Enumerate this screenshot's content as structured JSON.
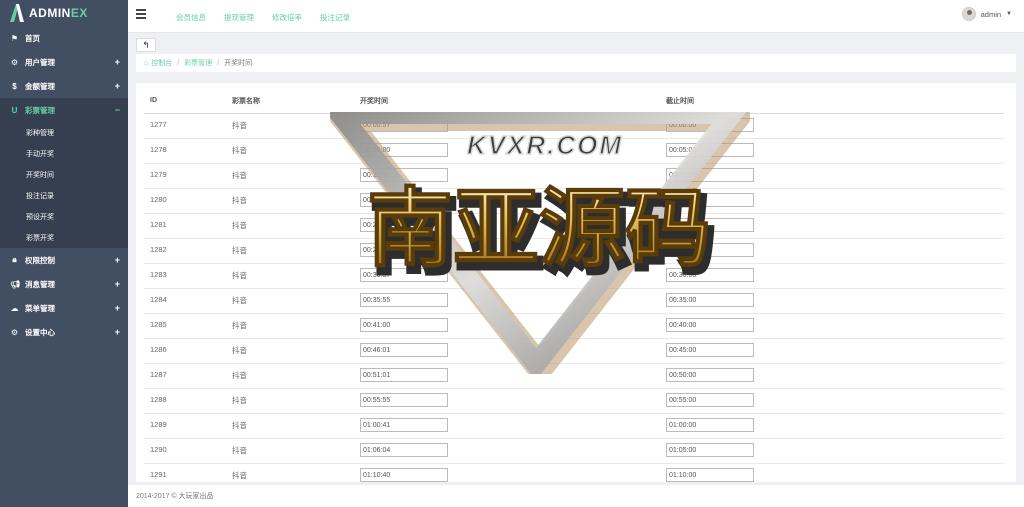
{
  "brand": {
    "prefix": "ADMIN",
    "suffix": "EX"
  },
  "sidebar": {
    "items": [
      {
        "label": "首页",
        "icon": "flag-icon",
        "glyph": "⚑",
        "toggle": ""
      },
      {
        "label": "用户管理",
        "icon": "gear-icon",
        "glyph": "⚙",
        "toggle": "+"
      },
      {
        "label": "金额管理",
        "icon": "dollar-icon",
        "glyph": "$",
        "toggle": "+"
      },
      {
        "label": "彩票管理",
        "icon": "magnet-icon",
        "glyph": "U",
        "toggle": "−"
      }
    ],
    "submenu": [
      "彩种管理",
      "手动开奖",
      "开奖时间",
      "投注记录",
      "预设开奖",
      "彩票开奖"
    ],
    "items2": [
      {
        "label": "权限控制",
        "icon": "lock-icon",
        "glyph": "🔒︎",
        "toggle": "+"
      },
      {
        "label": "消息管理",
        "icon": "bullhorn-icon",
        "glyph": "📢︎",
        "toggle": "+"
      },
      {
        "label": "菜单管理",
        "icon": "cloud-icon",
        "glyph": "☁",
        "toggle": "+"
      },
      {
        "label": "设置中心",
        "icon": "cog-icon",
        "glyph": "⚙",
        "toggle": "+"
      }
    ]
  },
  "header": {
    "nav": [
      "会员信息",
      "提现管理",
      "修改倍率",
      "投注记录"
    ],
    "user": "admin"
  },
  "breadcrumb": {
    "home": "控制台",
    "parent": "彩票管理",
    "current": "开奖时间"
  },
  "table": {
    "headers": [
      "ID",
      "彩票名称",
      "开奖时间",
      "截止时间"
    ],
    "rows": [
      {
        "id": "1277",
        "name": "抖音",
        "open": "00:00:57",
        "close": "00:00:00"
      },
      {
        "id": "1278",
        "name": "抖音",
        "open": "00:06:00",
        "close": "00:05:00"
      },
      {
        "id": "1279",
        "name": "抖音",
        "open": "00:11:00",
        "close": "00:10:00"
      },
      {
        "id": "1280",
        "name": "抖音",
        "open": "00:16:00",
        "close": "00:15:00"
      },
      {
        "id": "1281",
        "name": "抖音",
        "open": "00:20:59",
        "close": "00:20:00"
      },
      {
        "id": "1282",
        "name": "抖音",
        "open": "00:26:02",
        "close": "00:25:00"
      },
      {
        "id": "1283",
        "name": "抖音",
        "open": "00:30:57",
        "close": "00:30:00"
      },
      {
        "id": "1284",
        "name": "抖音",
        "open": "00:35:55",
        "close": "00:35:00"
      },
      {
        "id": "1285",
        "name": "抖音",
        "open": "00:41:00",
        "close": "00:40:00"
      },
      {
        "id": "1286",
        "name": "抖音",
        "open": "00:46:01",
        "close": "00:45:00"
      },
      {
        "id": "1287",
        "name": "抖音",
        "open": "00:51:01",
        "close": "00:50:00"
      },
      {
        "id": "1288",
        "name": "抖音",
        "open": "00:55:55",
        "close": "00:55:00"
      },
      {
        "id": "1289",
        "name": "抖音",
        "open": "01:00:41",
        "close": "01:00:00"
      },
      {
        "id": "1290",
        "name": "抖音",
        "open": "01:06:04",
        "close": "01:05:00"
      },
      {
        "id": "1291",
        "name": "抖音",
        "open": "01:10:40",
        "close": "01:10:00"
      }
    ]
  },
  "watermark": {
    "top": "KVXR.COM",
    "main": "南亚源码"
  },
  "footer": "2014-2017 © 大玩家出品",
  "colors": {
    "sidebar": "#424f63",
    "accent": "#65cea7",
    "page_bg": "#eff0f4"
  }
}
